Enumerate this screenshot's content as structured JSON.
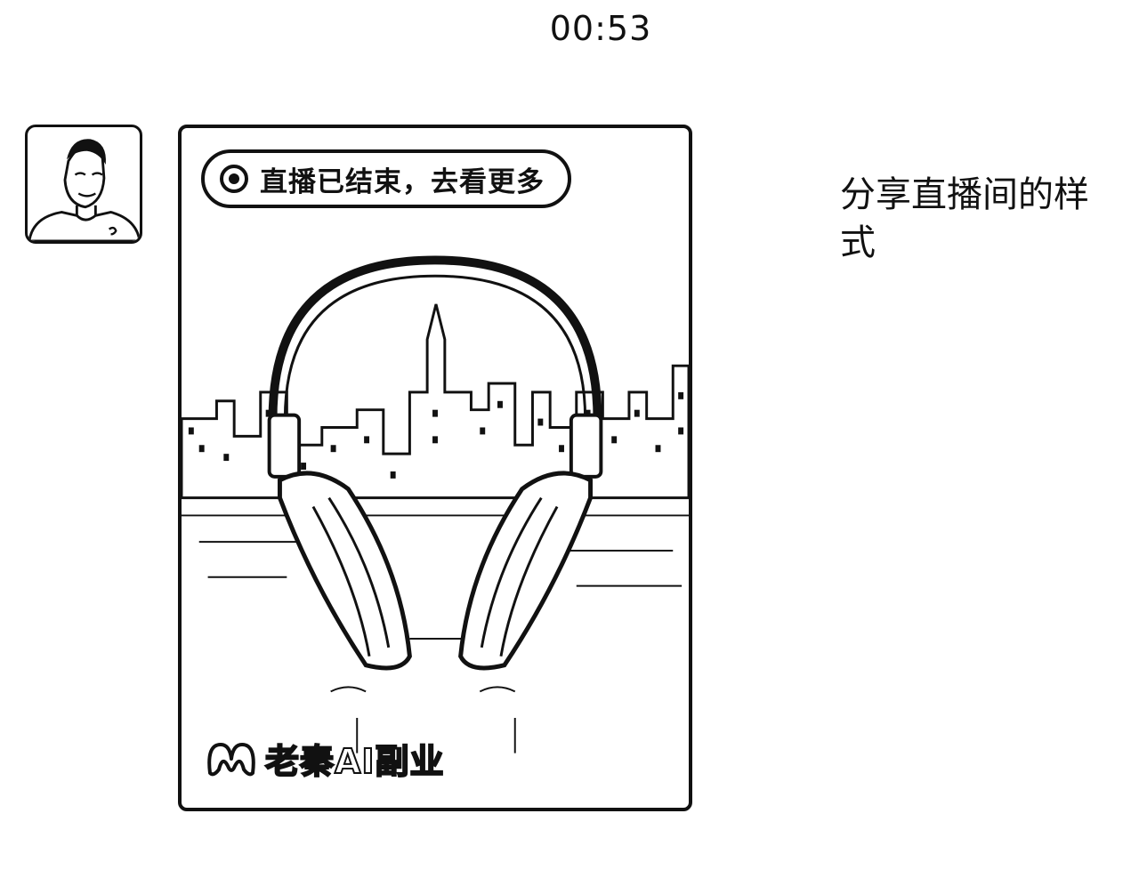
{
  "status_bar": {
    "time": "00:53"
  },
  "message": {
    "sender": {
      "avatar_icon": "user-avatar-icon"
    },
    "share_card": {
      "status_label": "直播已结束，去看更多",
      "status_icon": "live-record-icon",
      "brand_name": "老秦AI副业",
      "brand_logo": "channel-logo-icon",
      "cover_icon": "headphones-cover-icon"
    }
  },
  "caption": {
    "text": "分享直播间的样式"
  }
}
